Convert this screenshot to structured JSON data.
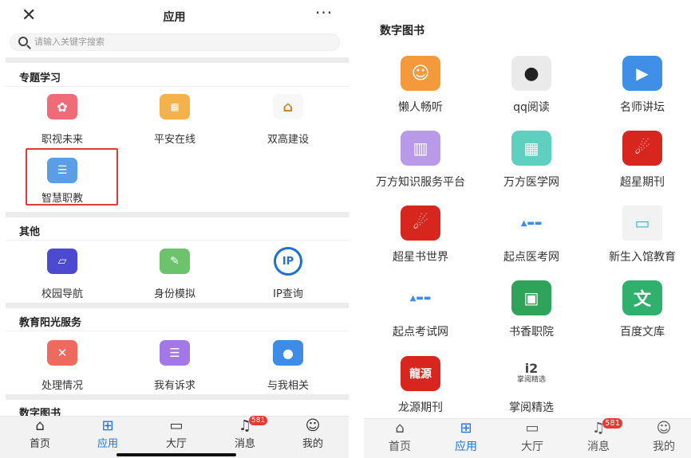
{
  "left": {
    "header": {
      "title": "应用",
      "close_icon": "close-icon",
      "more_icon": "more-icon",
      "more": "···",
      "close": "✕"
    },
    "search": {
      "placeholder": "请输入关键字搜索"
    },
    "sections": {
      "s1": {
        "title": "专题学习",
        "apps": [
          "职视未来",
          "平安在线",
          "双高建设",
          "智慧职教"
        ]
      },
      "s2": {
        "title": "其他",
        "apps": [
          "校园导航",
          "身份模拟",
          "IP查询"
        ]
      },
      "s3": {
        "title": "教育阳光服务",
        "apps": [
          "处理情况",
          "我有诉求",
          "与我相关"
        ]
      },
      "s4": {
        "title": "数字图书"
      }
    },
    "tabs": [
      "首页",
      "应用",
      "大厅",
      "消息",
      "我的"
    ],
    "badge": "581",
    "ip_icon_text": "IP"
  },
  "right": {
    "title": "数字图书",
    "apps": [
      "懒人畅听",
      "qq阅读",
      "名师讲坛",
      "万方知识服务平台",
      "万方医学网",
      "超星期刊",
      "超星书世界",
      "起点医考网",
      "新生入馆教育",
      "起点考试网",
      "书香职院",
      "百度文库",
      "龙源期刊",
      "掌阅精选"
    ],
    "tabs": [
      "首页",
      "应用",
      "大厅",
      "消息",
      "我的"
    ],
    "badge": "581",
    "icon_texts": {
      "longyuan": "龍源",
      "zhangyue_top": "i2",
      "zhangyue_sub": "掌阅精选",
      "baidu": "文"
    }
  },
  "colors": {
    "accent": "#1a73e8",
    "highlight": "#e53935",
    "divider": "#ececec"
  }
}
